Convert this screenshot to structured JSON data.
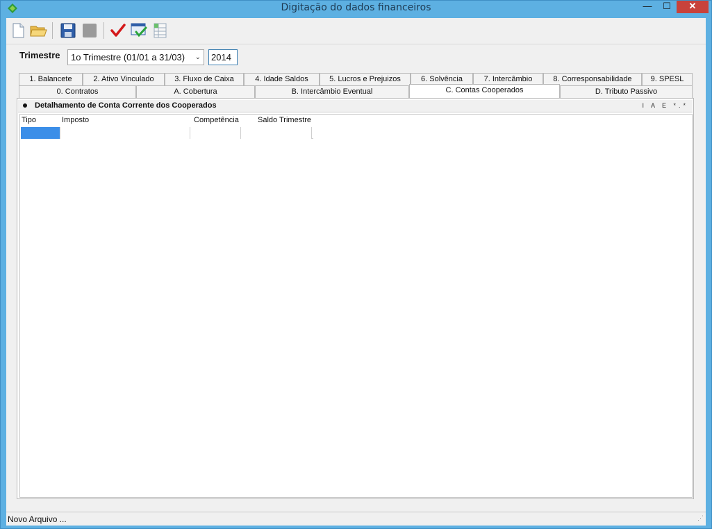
{
  "window": {
    "title": "Digitação do dados financeiros",
    "minimize": "—",
    "maximize": "☐",
    "close": "✕"
  },
  "toolbar": {
    "icons": [
      "new-document-icon",
      "open-folder-icon",
      "save-icon",
      "disabled-icon",
      "confirm-check-icon",
      "validate-icon",
      "spreadsheet-icon"
    ]
  },
  "filter": {
    "trimestre_label": "Trimestre",
    "trimestre_value": "1o Trimestre (01/01 a 31/03)",
    "year_value": "2014"
  },
  "tabs_row1": [
    "1. Balancete",
    "2. Ativo Vinculado",
    "3. Fluxo de Caixa",
    "4. Idade Saldos",
    "5. Lucros e Prejuizos",
    "6. Solvência",
    "7. Intercâmbio",
    "8. Corresponsabilidade",
    "9. SPESL"
  ],
  "tabs_row2": [
    "0. Contratos",
    "A. Cobertura",
    "B. Intercâmbio Eventual",
    "C. Contas Cooperados",
    "D. Tributo Passivo"
  ],
  "active_tab": "C. Contas Cooperados",
  "panel": {
    "title": "Detalhamento de Conta Corrente dos Cooperados",
    "flags": "I A E *.*",
    "columns": [
      "Tipo",
      "Imposto",
      "Competência",
      "Saldo Trimestre"
    ]
  },
  "status": {
    "text": "Novo Arquivo ..."
  },
  "colors": {
    "titlebar": "#5db0e2",
    "selection": "#3b8ee8",
    "close": "#c8423b"
  }
}
